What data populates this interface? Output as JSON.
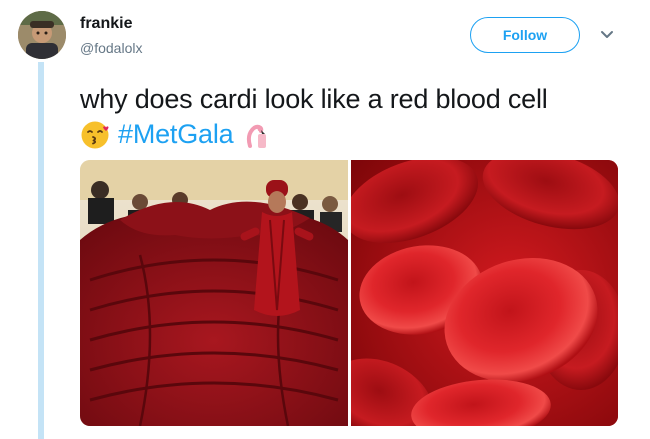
{
  "user": {
    "display_name": "frankie",
    "handle": "@fodalolx"
  },
  "follow_button": {
    "label": "Follow"
  },
  "tweet": {
    "line1": "why does cardi look like a red blood cell",
    "hashtag": "#MetGala",
    "emojis": [
      "kissing-face-emoji",
      "flamingo-emoji"
    ]
  },
  "media": {
    "left_image": "cardi-b-red-gown-photo",
    "right_image": "red-blood-cells-photo"
  },
  "colors": {
    "accent": "#1da1f2",
    "thread_line": "#c4e3f6",
    "text": "#14171a",
    "muted": "#657786"
  }
}
